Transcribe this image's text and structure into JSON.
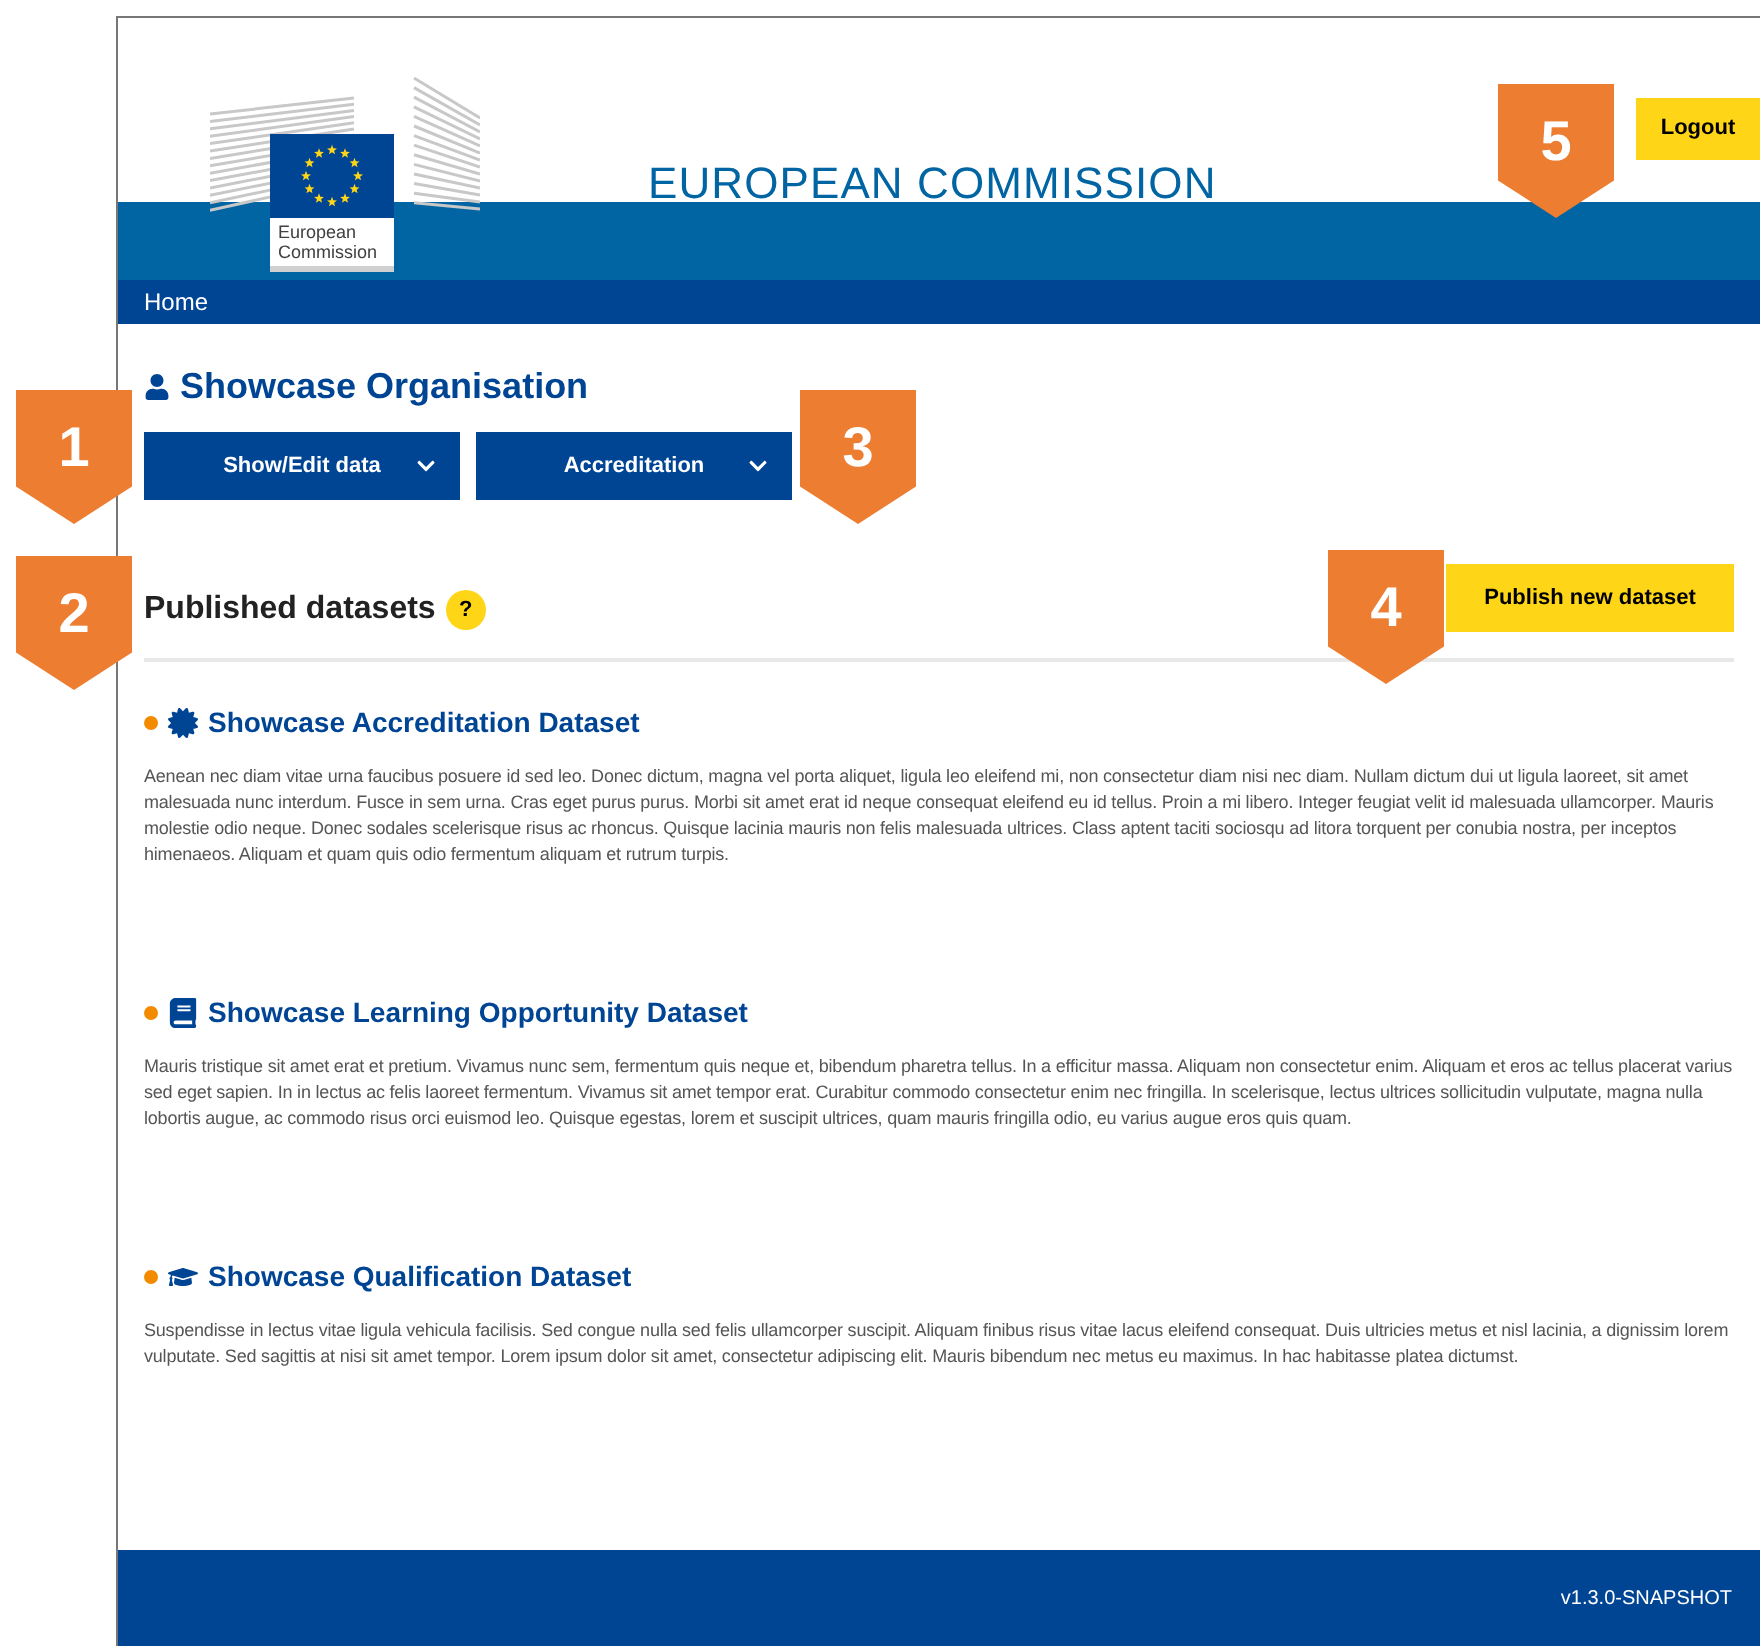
{
  "header": {
    "logo_caption": "European Commission",
    "title": "EUROPEAN COMMISSION",
    "logout": "Logout"
  },
  "nav": {
    "home": "Home"
  },
  "organisation": {
    "name": "Showcase Organisation",
    "menus": [
      {
        "label": "Show/Edit data"
      },
      {
        "label": "Accreditation"
      }
    ]
  },
  "datasets_section": {
    "title": "Published datasets",
    "help": "?",
    "publish": "Publish new dataset"
  },
  "datasets": [
    {
      "kind": "accreditation",
      "title": "Showcase Accreditation Dataset",
      "description": "Aenean nec diam vitae urna faucibus posuere id sed leo. Donec dictum, magna vel porta aliquet, ligula leo eleifend mi, non consectetur diam nisi nec diam. Nullam dictum dui ut ligula laoreet, sit amet malesuada nunc interdum. Fusce in sem urna. Cras eget purus purus. Morbi sit amet erat id neque consequat eleifend eu id tellus. Proin a mi libero. Integer feugiat velit id malesuada ullamcorper. Mauris molestie odio neque. Donec sodales scelerisque risus ac rhoncus. Quisque lacinia mauris non felis malesuada ultrices. Class aptent taciti sociosqu ad litora torquent per conubia nostra, per inceptos himenaeos. Aliquam et quam quis odio fermentum aliquam et rutrum turpis."
    },
    {
      "kind": "learning",
      "title": "Showcase Learning Opportunity Dataset",
      "description": "Mauris tristique sit amet erat et pretium. Vivamus nunc sem, fermentum quis neque et, bibendum pharetra tellus. In a efficitur massa. Aliquam non consectetur enim. Aliquam et eros ac tellus placerat varius sed eget sapien. In in lectus ac felis laoreet fermentum. Vivamus sit amet tempor erat. Curabitur commodo consectetur enim nec fringilla. In scelerisque, lectus ultrices sollicitudin vulputate, magna nulla lobortis augue, ac commodo risus orci euismod leo. Quisque egestas, lorem et suscipit ultrices, quam mauris fringilla odio, eu varius augue eros quis quam."
    },
    {
      "kind": "qualification",
      "title": "Showcase Qualification Dataset",
      "description": "Suspendisse in lectus vitae ligula vehicula facilisis. Sed congue nulla sed felis ullamcorper suscipit. Aliquam finibus risus vitae lacus eleifend consequat. Duis ultricies metus et nisl lacinia, a dignissim lorem vulputate. Sed sagittis at nisi sit amet tempor. Lorem ipsum dolor sit amet, consectetur adipiscing elit. Mauris bibendum nec metus eu maximus. In hac habitasse platea dictumst."
    }
  ],
  "footer": {
    "version": "v1.3.0-SNAPSHOT"
  },
  "markers": [
    {
      "label": "1"
    },
    {
      "label": "2"
    },
    {
      "label": "3"
    },
    {
      "label": "4"
    },
    {
      "label": "5"
    }
  ]
}
